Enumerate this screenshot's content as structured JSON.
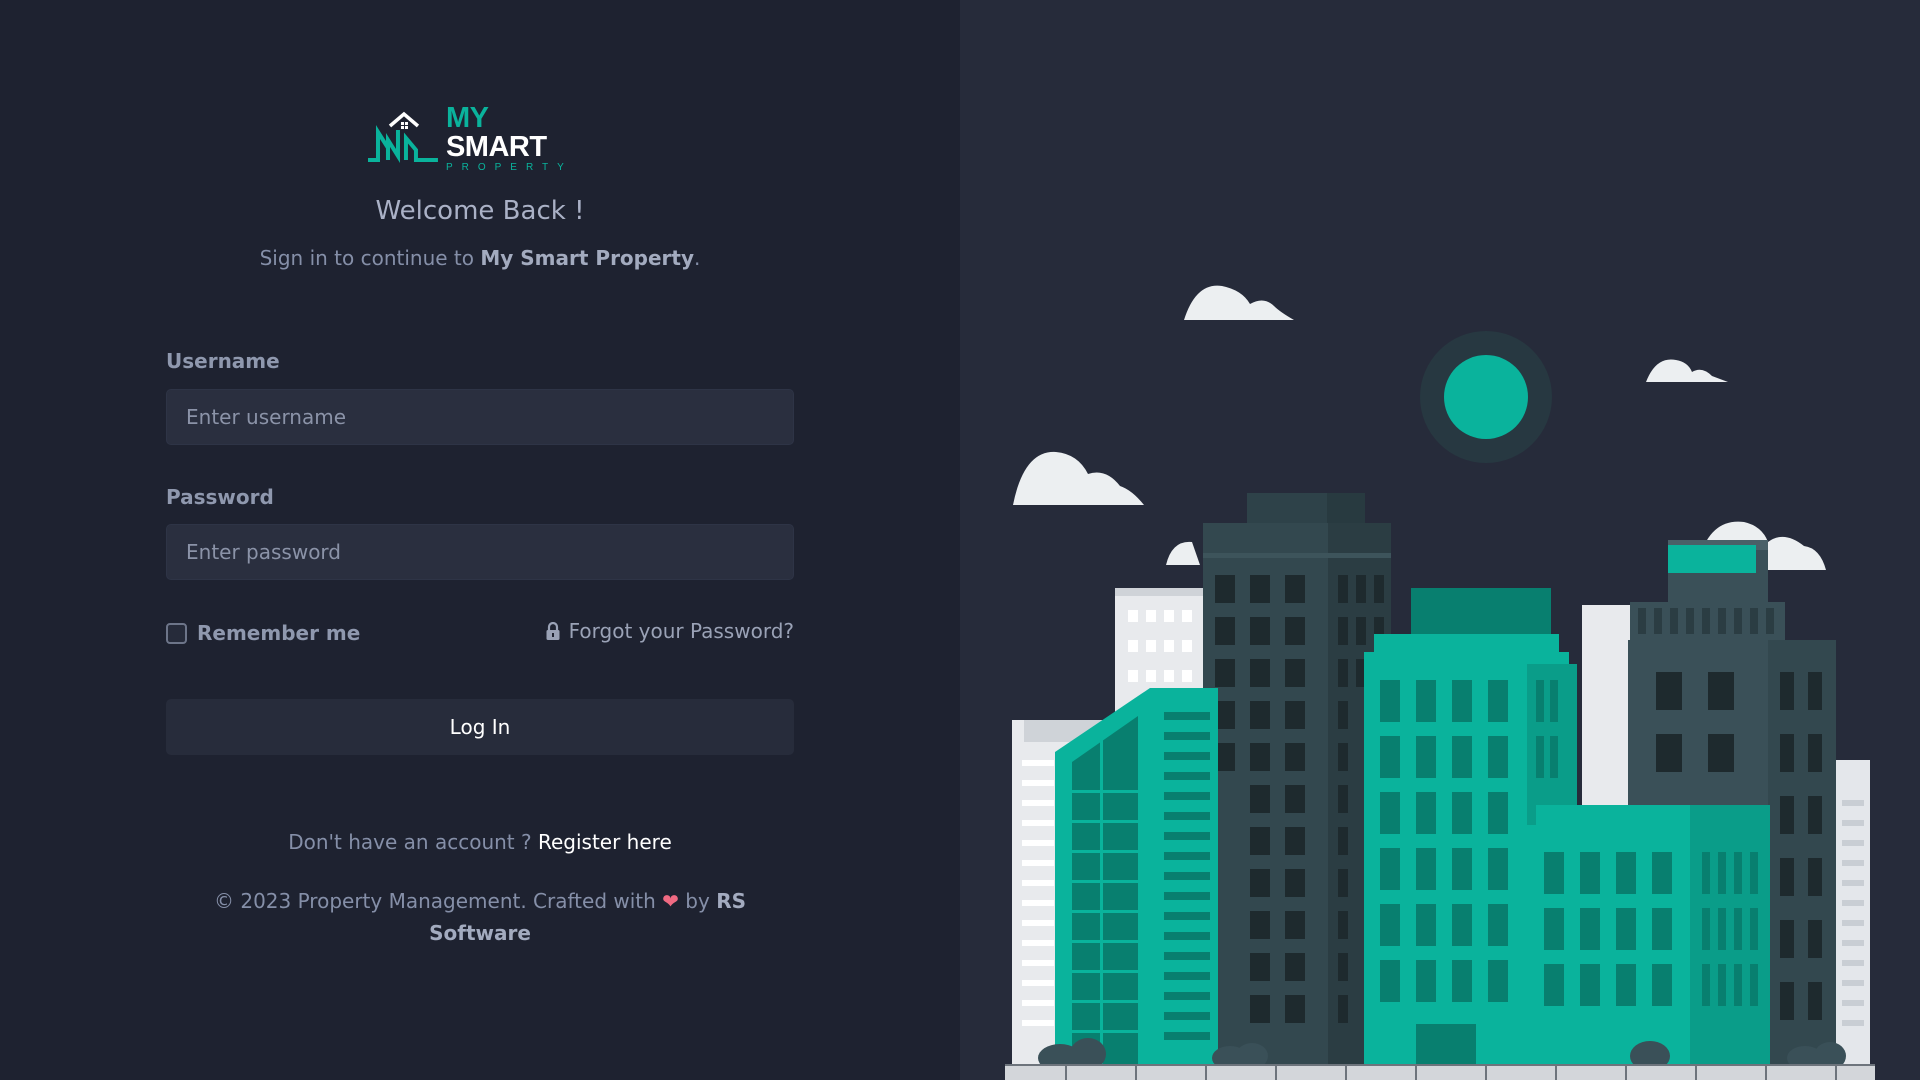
{
  "brand": {
    "logo_word_1": "MY",
    "logo_word_2": "SMART",
    "logo_tagline": "PROPERTY",
    "accent_color": "#0ab39c"
  },
  "login": {
    "welcome": "Welcome Back !",
    "subtitle_prefix": "Sign in to continue to ",
    "subtitle_brand": "My Smart Property",
    "subtitle_suffix": ".",
    "username_label": "Username",
    "username_placeholder": "Enter username",
    "username_value": "",
    "password_label": "Password",
    "password_placeholder": "Enter password",
    "password_value": "",
    "remember_label": "Remember me",
    "remember_checked": false,
    "forgot_label": "Forgot your Password?",
    "forgot_icon": "lock-icon",
    "login_button": "Log In"
  },
  "register": {
    "prompt": "Don't have an account ? ",
    "link": "Register here"
  },
  "footer": {
    "prefix": "© 2023 Property Management. Crafted with ",
    "heart_icon": "heart-icon",
    "by": " by ",
    "company": "RS Software"
  },
  "illustration": {
    "name": "city-skyline-illustration"
  }
}
